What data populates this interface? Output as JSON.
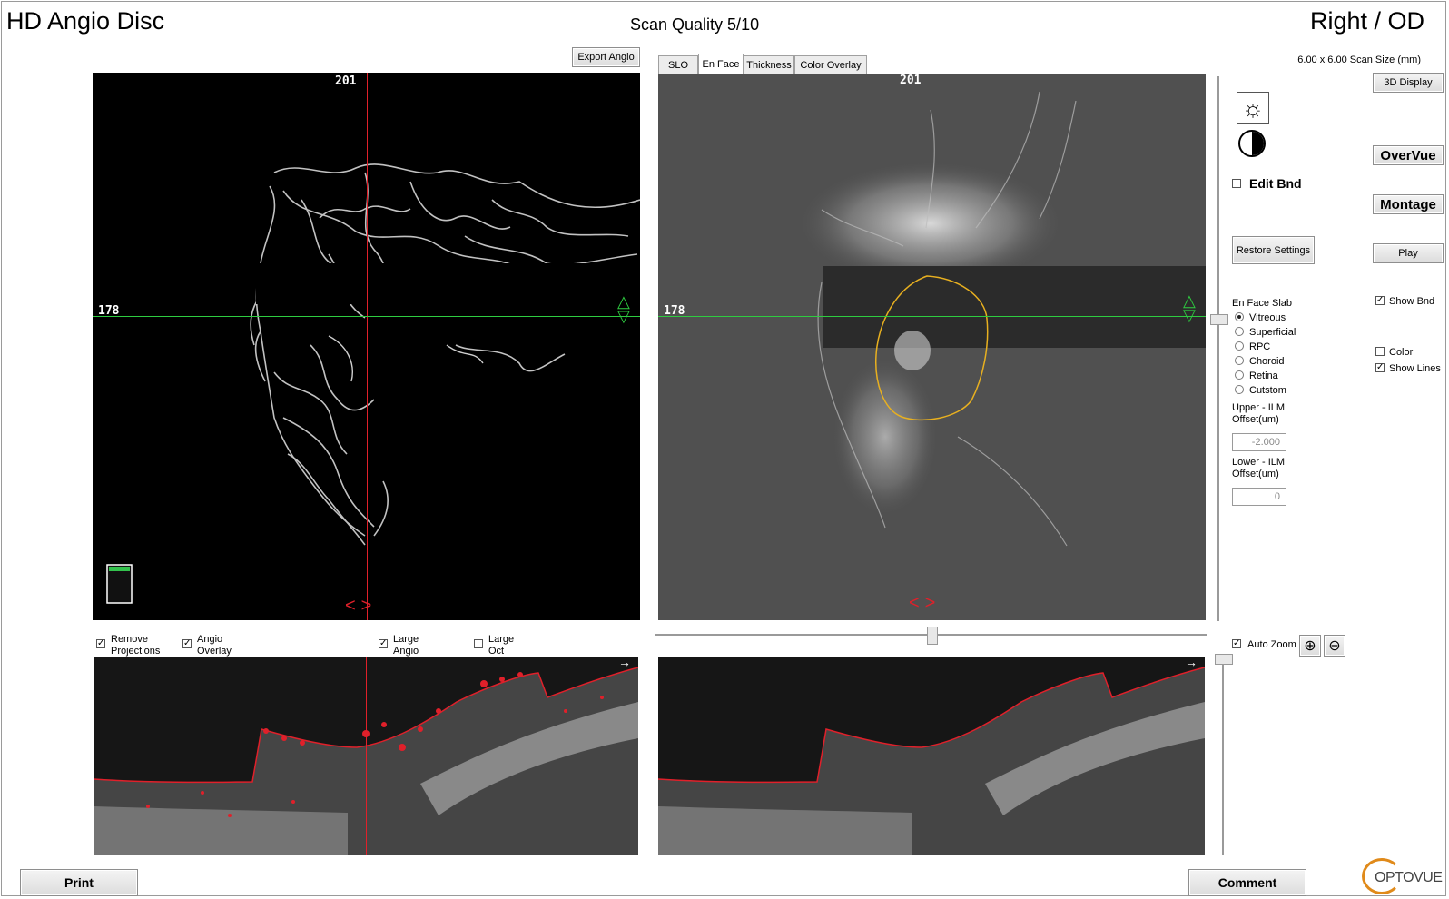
{
  "header": {
    "title": "HD Angio Disc",
    "scan_quality": "Scan Quality 5/10",
    "eye": "Right / OD",
    "scan_size": "6.00 x 6.00 Scan Size (mm)"
  },
  "left_panel": {
    "export_button": "Export Angio",
    "x_marker": "201",
    "y_marker": "178"
  },
  "right_panel": {
    "tabs": [
      {
        "label": "SLO",
        "active": false
      },
      {
        "label": "En Face",
        "active": true
      },
      {
        "label": "Thickness",
        "active": false
      },
      {
        "label": "Color Overlay",
        "active": false
      }
    ],
    "x_marker": "201",
    "y_marker": "178"
  },
  "controls": {
    "brightness_icon": "brightness-icon",
    "contrast_icon": "contrast-icon",
    "edit_bnd": {
      "label": "Edit Bnd",
      "checked": false
    },
    "restore_settings": "Restore Settings",
    "en_face_slab": {
      "title": "En Face Slab",
      "options": [
        "Vitreous",
        "Superficial",
        "RPC",
        "Choroid",
        "Retina",
        "Cutstom"
      ],
      "selected": "Vitreous"
    },
    "upper_offset": {
      "label1": "Upper - ILM",
      "label2": "Offset(um)",
      "value": "-2.000"
    },
    "lower_offset": {
      "label1": "Lower - ILM",
      "label2": "Offset(um)",
      "value": "0"
    },
    "auto_zoom": {
      "label": "Auto Zoom",
      "checked": true
    }
  },
  "side_buttons": {
    "display_3d": "3D Display",
    "overvue": "OverVue",
    "montage": "Montage",
    "play": "Play",
    "show_bnd": {
      "label": "Show Bnd",
      "checked": true
    },
    "color": {
      "label": "Color",
      "checked": false
    },
    "show_lines": {
      "label": "Show Lines",
      "checked": true
    }
  },
  "bscan_options": [
    {
      "line1": "Remove",
      "line2": "Projections",
      "checked": true
    },
    {
      "line1": "Angio",
      "line2": "Overlay",
      "checked": true
    },
    {
      "line1": "Large",
      "line2": "Angio",
      "checked": true
    },
    {
      "line1": "Large",
      "line2": "Oct",
      "checked": false
    }
  ],
  "footer": {
    "print": "Print",
    "comment": "Comment",
    "logo": "OPTOVUE"
  },
  "colors": {
    "crosshair_red": "#e0202a",
    "crosshair_green": "#2ecc40",
    "boundary_yellow": "#e8b020",
    "segmentation_red": "#e0202a"
  }
}
